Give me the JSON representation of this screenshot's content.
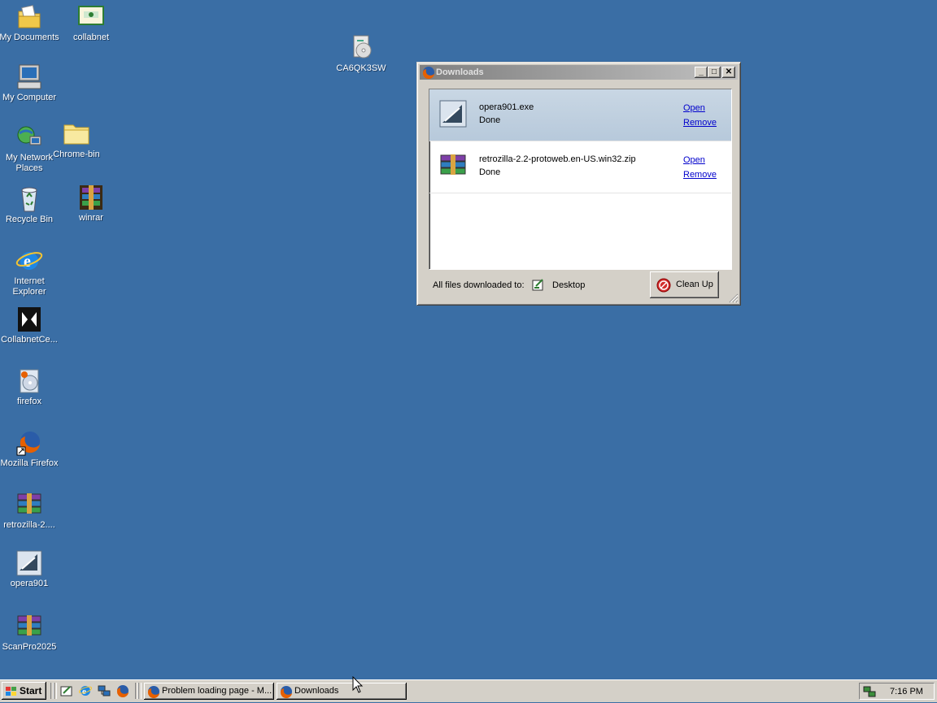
{
  "desktop": {
    "icons": [
      {
        "label": "My Documents",
        "icon": "my-documents-icon"
      },
      {
        "label": "collabnet",
        "icon": "collabnet-icon"
      },
      {
        "label": "CA6QK3SW",
        "icon": "cd-drive-icon"
      },
      {
        "label": "My Computer",
        "icon": "my-computer-icon"
      },
      {
        "label": "My Network Places",
        "icon": "network-places-icon"
      },
      {
        "label": "Chrome-bin",
        "icon": "folder-icon"
      },
      {
        "label": "Recycle Bin",
        "icon": "recycle-bin-icon"
      },
      {
        "label": "winrar",
        "icon": "winrar-icon"
      },
      {
        "label": "Internet Explorer",
        "icon": "internet-explorer-icon"
      },
      {
        "label": "CollabnetCe...",
        "icon": "collabnet-cert-icon"
      },
      {
        "label": "firefox",
        "icon": "firefox-installer-icon"
      },
      {
        "label": "Mozilla Firefox",
        "icon": "mozilla-firefox-icon"
      },
      {
        "label": "retrozilla-2....",
        "icon": "archive-icon"
      },
      {
        "label": "opera901",
        "icon": "opera-installer-icon"
      },
      {
        "label": "ScanPro2025",
        "icon": "archive-icon"
      }
    ]
  },
  "downloads_window": {
    "title": "Downloads",
    "items": [
      {
        "filename": "opera901.exe",
        "status": "Done",
        "open_label": "Open",
        "remove_label": "Remove"
      },
      {
        "filename": "retrozilla-2.2-protoweb.en-US.win32.zip",
        "status": "Done",
        "open_label": "Open",
        "remove_label": "Remove"
      }
    ],
    "footer": {
      "label": "All files downloaded to:",
      "folder": "Desktop",
      "cleanup_label": "Clean Up"
    }
  },
  "taskbar": {
    "start_label": "Start",
    "tasks": [
      {
        "label": "Problem loading page - M..."
      },
      {
        "label": "Downloads"
      }
    ],
    "clock": "7:16 PM"
  },
  "colors": {
    "desktop": "#3a6ea5",
    "selected_row": "#c0d0e0",
    "link": "#0000cc"
  }
}
